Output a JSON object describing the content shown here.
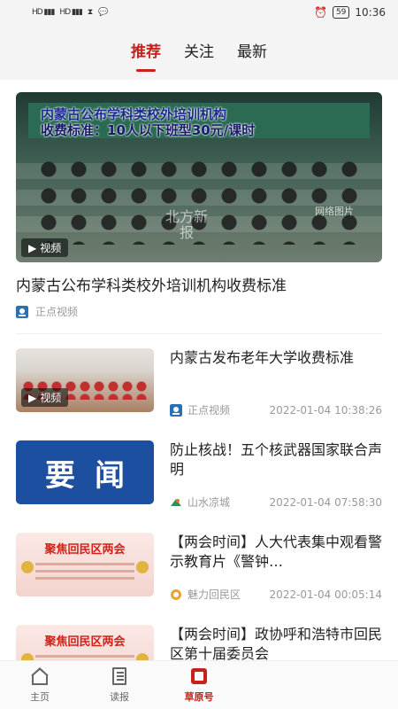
{
  "status": {
    "left_icons": [
      "hd-icon",
      "signal-4g-icon",
      "signal-4g-icon",
      "hourglass-icon",
      "chat-icon"
    ],
    "left_text": "HD 4G 4G",
    "battery": "59",
    "time": "10:36"
  },
  "tabs": [
    {
      "label": "推荐",
      "active": true
    },
    {
      "label": "关注",
      "active": false
    },
    {
      "label": "最新",
      "active": false
    }
  ],
  "feature": {
    "banner_line1": "内蒙古公布学科类校外培训机构",
    "banner_line2": "收费标准：10人以下班型30元/课时",
    "watermark": "网络图片",
    "watermark2": "北方新报",
    "video_label": "视频",
    "title": "内蒙古公布学科类校外培训机构收费标准",
    "source": "正点视频"
  },
  "items": [
    {
      "title": "内蒙古发布老年大学收费标准",
      "source": "正点视频",
      "date": "2022-01-04 10:38:26",
      "video_label": "视频"
    },
    {
      "title": "防止核战！五个核武器国家联合声明",
      "source": "山水凉城",
      "date": "2022-01-04 07:58:30",
      "thumb_text": "要闻"
    },
    {
      "title": "【两会时间】人大代表集中观看警示教育片《警钟…",
      "source": "魅力回民区",
      "date": "2022-01-04 00:05:14",
      "thumb_text": "聚焦回民区两会"
    },
    {
      "title": "【两会时间】政协呼和浩特市回民区第十届委员会",
      "source": "",
      "date": "",
      "thumb_text": "聚焦回民区两会"
    }
  ],
  "nav": [
    {
      "label": "主页",
      "icon": "home-icon",
      "active": false
    },
    {
      "label": "读报",
      "icon": "newspaper-icon",
      "active": false
    },
    {
      "label": "草原号",
      "icon": "grassland-icon",
      "active": true
    }
  ],
  "colors": {
    "accent": "#c8201d",
    "yaowen_blue": "#1d4fa0"
  }
}
